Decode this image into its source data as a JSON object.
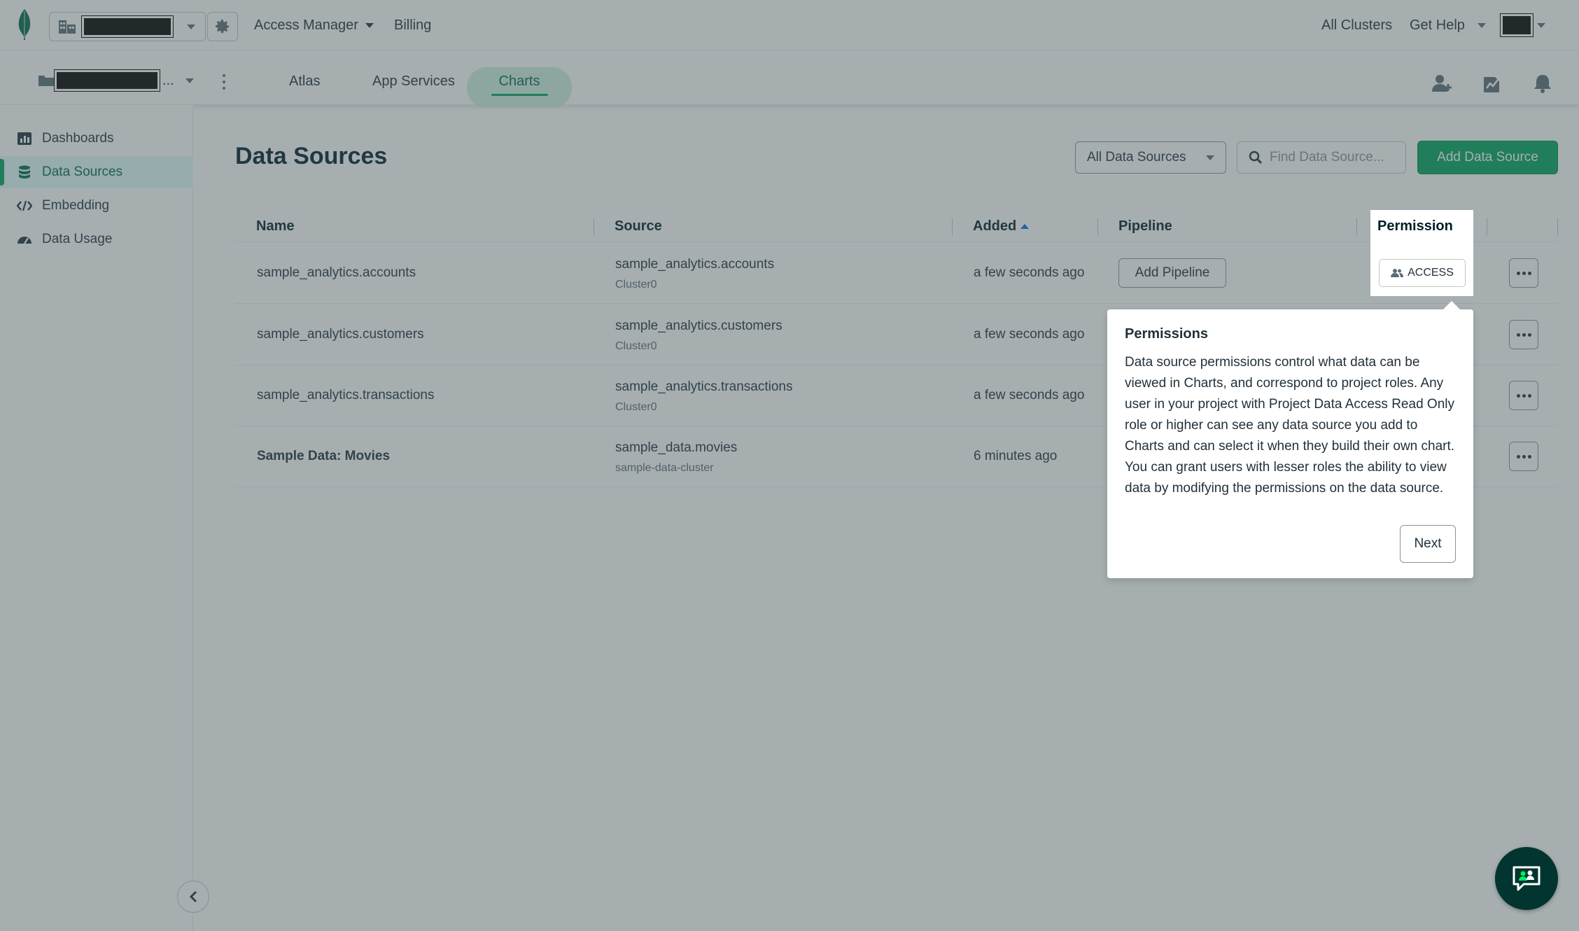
{
  "topbar": {
    "access_manager": "Access Manager",
    "billing": "Billing",
    "all_clusters": "All Clusters",
    "get_help": "Get Help"
  },
  "projectbar": {
    "project_ellipsis": "...",
    "tabs": [
      {
        "label": "Atlas",
        "active": false
      },
      {
        "label": "App Services",
        "active": false
      },
      {
        "label": "Charts",
        "active": true
      }
    ]
  },
  "sidebar": {
    "items": [
      {
        "label": "Dashboards",
        "icon": "bar-chart-icon",
        "active": false
      },
      {
        "label": "Data Sources",
        "icon": "database-icon",
        "active": true
      },
      {
        "label": "Embedding",
        "icon": "code-icon",
        "active": false
      },
      {
        "label": "Data Usage",
        "icon": "gauge-icon",
        "active": false
      }
    ]
  },
  "main": {
    "title": "Data Sources",
    "filter_value": "All Data Sources",
    "search_placeholder": "Find Data Source...",
    "add_button": "Add Data Source",
    "columns": {
      "name": "Name",
      "source": "Source",
      "added": "Added",
      "pipeline": "Pipeline",
      "permission": "Permission"
    },
    "rows": [
      {
        "name": "sample_analytics.accounts",
        "source": "sample_analytics.accounts",
        "cluster": "Cluster0",
        "added": "a few seconds ago",
        "pipeline": "Add Pipeline"
      },
      {
        "name": "sample_analytics.customers",
        "source": "sample_analytics.customers",
        "cluster": "Cluster0",
        "added": "a few seconds ago"
      },
      {
        "name": "sample_analytics.transactions",
        "source": "sample_analytics.transactions",
        "cluster": "Cluster0",
        "added": "a few seconds ago"
      },
      {
        "name": "Sample Data: Movies",
        "source": "sample_data.movies",
        "cluster": "sample-data-cluster",
        "added": "6 minutes ago"
      }
    ],
    "access_button": "ACCESS"
  },
  "popover": {
    "title": "Permissions",
    "body": "Data source permissions control what data can be viewed in Charts, and correspond to project roles. Any user in your project with Project Data Access Read Only role or higher can see any data source you add to Charts and can select it when they build their own chart. You can grant users with lesser roles the ability to view data by modifying the permissions on the data source.",
    "next": "Next"
  },
  "colors": {
    "brand_green": "#00a35c",
    "active_text": "#00684a",
    "sort_blue": "#016bf8"
  }
}
